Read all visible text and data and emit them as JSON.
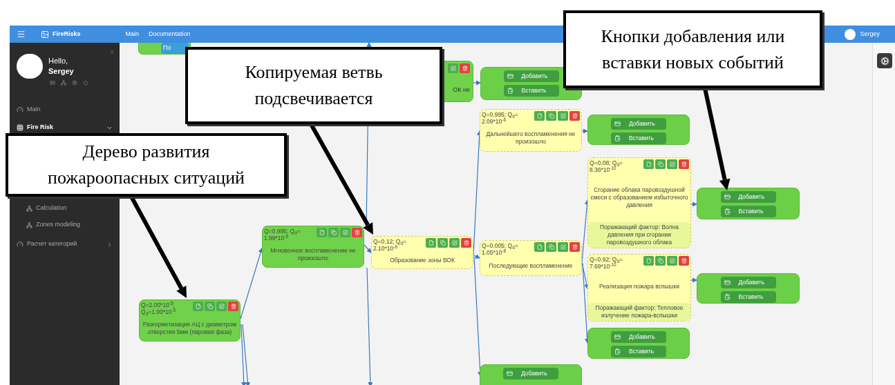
{
  "topbar": {
    "brand": "FireRisks",
    "nav": [
      {
        "label": "Main"
      },
      {
        "label": "Documentation"
      }
    ],
    "user": "Sergey"
  },
  "sidebar": {
    "close": "×",
    "greeting": "Hello,",
    "user": "Sergey",
    "items": [
      {
        "label": "Main"
      },
      {
        "label": "Fire Risk",
        "expanded": true,
        "children": [
          {
            "label": "Calculation"
          },
          {
            "label": "Zones modeling"
          }
        ]
      },
      {
        "label": "Расчет категорий",
        "expanded": false
      }
    ]
  },
  "canvas": {
    "nodes": [
      {
        "kind": "stub",
        "highlighted": false,
        "button": "По"
      },
      {
        "kind": "partial",
        "highlighted": false,
        "title": "ОК не"
      },
      {
        "kind": "add",
        "buttons": [
          {
            "kind": "add",
            "label": "Добавить"
          },
          {
            "kind": "paste",
            "label": "Вставить"
          }
        ]
      },
      {
        "kind": "event",
        "highlighted": true,
        "q": "Q=0.995; Q$_{d}$= 2.09*10$^{-6}$",
        "title": "Дальнейшего воспламенения не произошло"
      },
      {
        "kind": "add",
        "buttons": [
          {
            "kind": "add",
            "label": "Добавить"
          },
          {
            "kind": "paste",
            "label": "Вставить"
          }
        ]
      },
      {
        "kind": "event",
        "highlighted": true,
        "q": "Q=0.08; Q$_{d}$= 8.36*10$^{-10}$",
        "title": "Сгорание облака паровоздушной смеси с образованием избыточного давления",
        "factor": "Поражающий фактор: Волна давления при сгорании паровоздушного облака"
      },
      {
        "kind": "event",
        "highlighted": false,
        "q": "Q=0.995; Q$_{d}$= 1.99*10$^{-5}$",
        "title": "Мгновенное воспламенение не произошло"
      },
      {
        "kind": "event",
        "highlighted": true,
        "q": "Q=0.12; Q$_{d}$= 2.10*10$^{-6}$",
        "title": "Образование зоны ВОК"
      },
      {
        "kind": "event",
        "highlighted": true,
        "q": "Q=0.005; Q$_{d}$= 1.05*10$^{-8}$",
        "title": "Последующие воспламенение"
      },
      {
        "kind": "add",
        "buttons": [
          {
            "kind": "add",
            "label": "Добавить"
          },
          {
            "kind": "paste",
            "label": "Вставить"
          }
        ]
      },
      {
        "kind": "event",
        "highlighted": true,
        "q": "Q=0.92; Q$_{d}$= 7.69*10$^{-10}$",
        "title": "Реализация пожара вспышки",
        "factor": "Поражающий фактор: Тепловое излучение пожара-вспышки"
      },
      {
        "kind": "add",
        "buttons": [
          {
            "kind": "add",
            "label": "Добавить"
          },
          {
            "kind": "paste",
            "label": "Вставить"
          }
        ]
      },
      {
        "kind": "event",
        "highlighted": false,
        "q": "Q=2.00*10$^{-5}$; Q$_{d}$=1.00*10$^{-5}$",
        "title": "Разгерметизация АЦ с диаметром отверстия 5мм (паровая фаза)"
      },
      {
        "kind": "add",
        "buttons": [
          {
            "kind": "add",
            "label": "Добавить"
          },
          {
            "kind": "paste",
            "label": "Вставить"
          }
        ]
      },
      {
        "kind": "add",
        "buttons": [
          {
            "kind": "add",
            "label": "Добавить"
          }
        ]
      }
    ]
  },
  "callouts": [
    {
      "text": "Копируемая ветвь подсвечивается"
    },
    {
      "text": "Кнопки добавления или вставки новых событий"
    },
    {
      "text": "Дерево развития пожароопасных ситуаций"
    }
  ]
}
